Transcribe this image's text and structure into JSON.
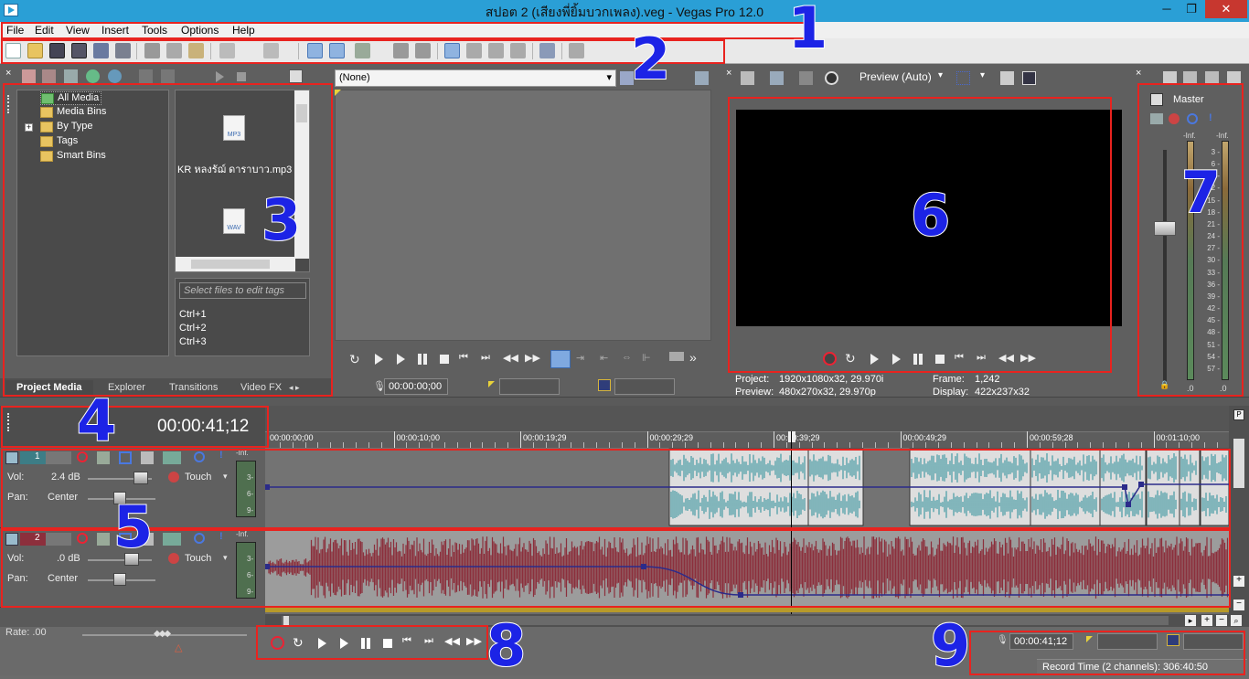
{
  "window": {
    "title": "สปอต 2 (เสียงพี่ยิ้มบวกเพลง).veg - Vegas Pro 12.0",
    "minimize": "─",
    "maximize": "❐",
    "close": "✕"
  },
  "menu": [
    "File",
    "Edit",
    "View",
    "Insert",
    "Tools",
    "Options",
    "Help"
  ],
  "media_panel": {
    "tree": [
      "All Media",
      "Media Bins",
      "By Type",
      "Tags",
      "Smart Bins"
    ],
    "files": [
      {
        "label": "KR หลงรัฌ์ ดาราบาว.mp3",
        "type": "MP3"
      },
      {
        "label": "",
        "type": "WAV"
      }
    ],
    "tags_placeholder": "Select files to edit tags",
    "shortcuts": [
      "Ctrl+1",
      "Ctrl+2",
      "Ctrl+3"
    ],
    "tabs": [
      "Project Media",
      "Explorer",
      "Transitions",
      "Video FX"
    ]
  },
  "trimmer": {
    "source_select": "(None)",
    "timecode": "00:00:00;00"
  },
  "preview": {
    "mode": "Preview (Auto)",
    "project_label": "Project:",
    "project_value": "1920x1080x32, 29.970i",
    "preview_label": "Preview:",
    "preview_value": "480x270x32, 29.970p",
    "frame_label": "Frame:",
    "frame_value": "1,242",
    "display_label": "Display:",
    "display_value": "422x237x32"
  },
  "mixer": {
    "master_label": "Master",
    "inf_left": "-Inf.",
    "inf_right": "-Inf.",
    "scale": [
      "3",
      "6",
      "9",
      "12",
      "15",
      "18",
      "21",
      "24",
      "27",
      "30",
      "33",
      "36",
      "39",
      "42",
      "45",
      "48",
      "51",
      "54",
      "57"
    ],
    "bottom_left": ".0",
    "bottom_right": ".0"
  },
  "timeline": {
    "cursor_time": "00:00:41;12",
    "ruler": [
      "00:00:00;00",
      "00:00:10;00",
      "00:00:19;29",
      "00:00:29;29",
      "00:00:39;29",
      "00:00:49;29",
      "00:00:59;28",
      "00:01:10;00"
    ],
    "tracks": [
      {
        "number": "1",
        "vol_label": "Vol:",
        "vol_value": "2.4 dB",
        "pan_label": "Pan:",
        "pan_value": "Center",
        "mode": "Touch",
        "meter_top": "-Inf.",
        "meter_marks": [
          "3-",
          "6-",
          "9-"
        ],
        "color": "#5aa4ac"
      },
      {
        "number": "2",
        "vol_label": "Vol:",
        "vol_value": ".0 dB",
        "pan_label": "Pan:",
        "pan_value": "Center",
        "mode": "Touch",
        "meter_top": "-Inf.",
        "meter_marks": [
          "3-",
          "6-",
          "9-"
        ],
        "color": "#8c2f3c"
      }
    ],
    "rate_label": "Rate: .00"
  },
  "status": {
    "timecode": "00:00:41;12",
    "record_time": "Record Time (2 channels): 306:40:50"
  },
  "annotations": [
    "1",
    "2",
    "3",
    "4",
    "5",
    "6",
    "7",
    "8",
    "9"
  ],
  "colors": {
    "title_bar": "#2a9fd6",
    "highlight": "#e8231f",
    "annotation": "#1c23e6"
  }
}
